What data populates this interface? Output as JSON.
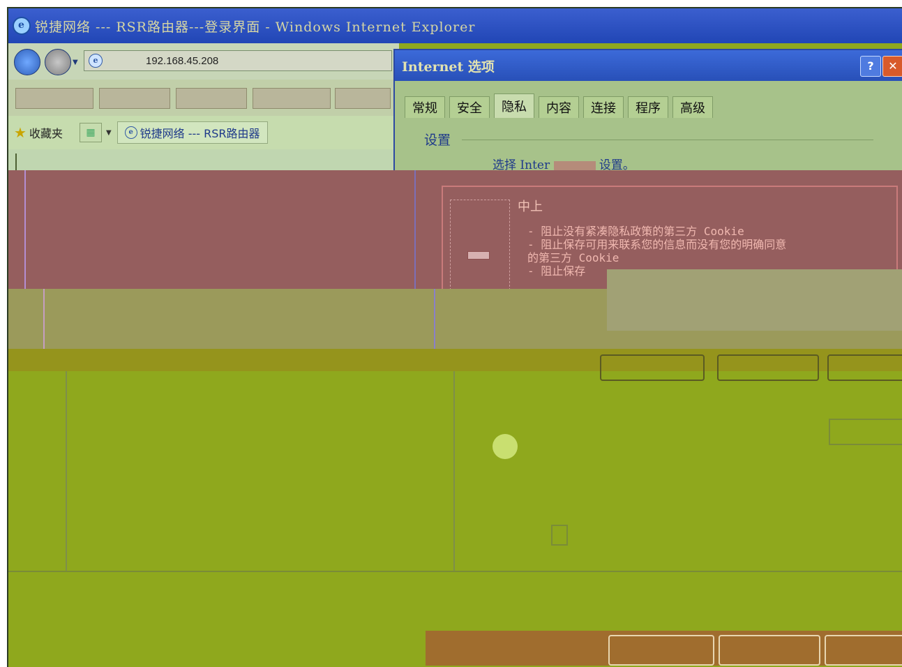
{
  "window": {
    "title": "锐捷网络 --- RSR路由器---登录界面 - Windows Internet Explorer"
  },
  "address": {
    "url": "192.168.45.208"
  },
  "favorites": {
    "label": "收藏夹",
    "tab_label": "锐捷网络 --- RSR路由器"
  },
  "dialog": {
    "title": "Internet 选项",
    "help": "?",
    "close": "✕",
    "tabs": [
      "常规",
      "安全",
      "隐私",
      "内容",
      "连接",
      "程序",
      "高级"
    ],
    "active_tab": "隐私",
    "settings_label": "设置",
    "move_text": "选择 Inter",
    "move_text_tail": "设置。",
    "level": "中上",
    "level_lines": [
      "- 阻止没有紧凑隐私政策的第三方 Cookie",
      "- 阻止保存可用来联系您的信息而没有您的明确同意",
      "的第三方 Cookie",
      "- 阻止保存"
    ]
  },
  "colors": {
    "page_olive": "#8fa81d",
    "title_blue": "#2146b5",
    "rose_panel": "#955e5e"
  }
}
